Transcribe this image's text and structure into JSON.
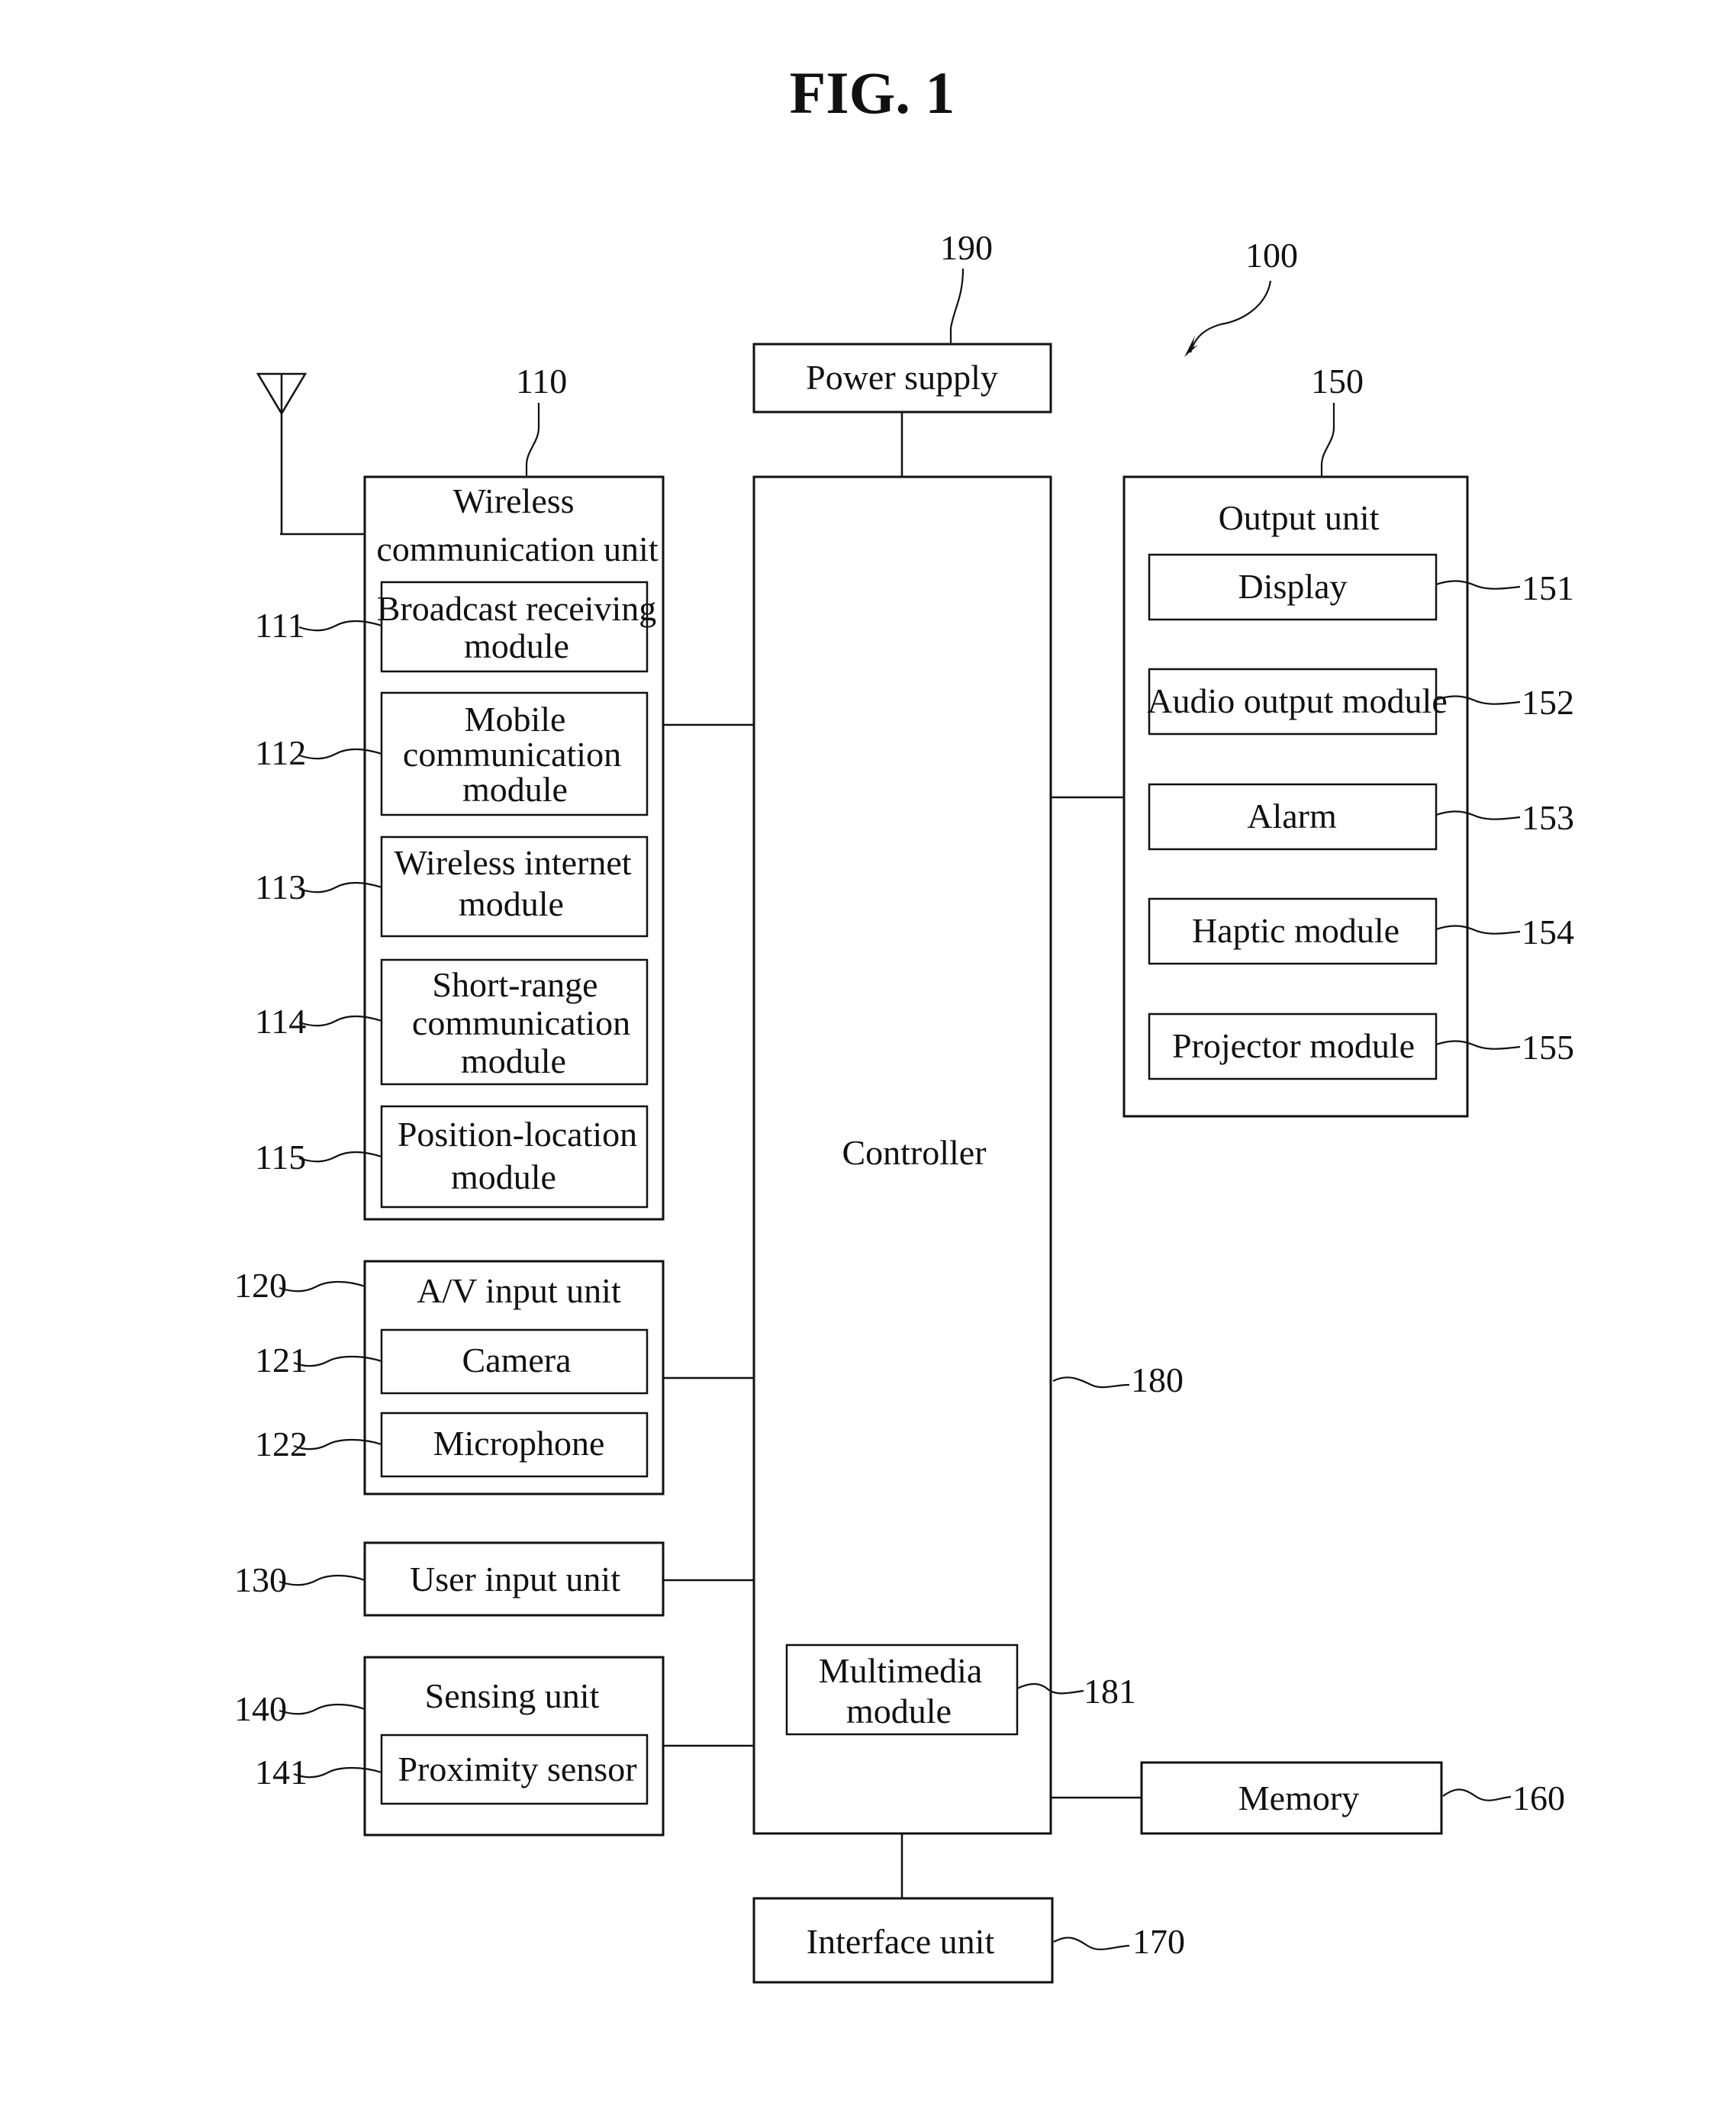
{
  "figure": {
    "title": "FIG. 1",
    "device_ref": "100"
  },
  "power_supply": {
    "label": "Power supply",
    "ref": "190"
  },
  "controller": {
    "label": "Controller",
    "ref": "180",
    "multimedia": {
      "label_lines": [
        "Multimedia",
        "module"
      ],
      "ref": "181"
    }
  },
  "wireless_unit": {
    "label_lines": [
      "Wireless",
      "communication unit"
    ],
    "ref": "110",
    "modules": [
      {
        "ref": "111",
        "label_lines": [
          "Broadcast receiving",
          "module"
        ]
      },
      {
        "ref": "112",
        "label_lines": [
          "Mobile",
          "communication",
          "module"
        ]
      },
      {
        "ref": "113",
        "label_lines": [
          "Wireless internet",
          "module"
        ]
      },
      {
        "ref": "114",
        "label_lines": [
          "Short-range",
          "communication",
          "module"
        ]
      },
      {
        "ref": "115",
        "label_lines": [
          "Position-location",
          "module"
        ]
      }
    ]
  },
  "av_input_unit": {
    "label": "A/V input unit",
    "ref": "120",
    "modules": [
      {
        "ref": "121",
        "label": "Camera"
      },
      {
        "ref": "122",
        "label": "Microphone"
      }
    ]
  },
  "user_input_unit": {
    "label": "User input unit",
    "ref": "130"
  },
  "sensing_unit": {
    "label": "Sensing unit",
    "ref": "140",
    "modules": [
      {
        "ref": "141",
        "label": "Proximity sensor"
      }
    ]
  },
  "output_unit": {
    "label": "Output unit",
    "ref": "150",
    "modules": [
      {
        "ref": "151",
        "label": "Display"
      },
      {
        "ref": "152",
        "label": "Audio output module"
      },
      {
        "ref": "153",
        "label": "Alarm"
      },
      {
        "ref": "154",
        "label": "Haptic module"
      },
      {
        "ref": "155",
        "label": "Projector module"
      }
    ]
  },
  "memory": {
    "label": "Memory",
    "ref": "160"
  },
  "interface_unit": {
    "label": "Interface unit",
    "ref": "170"
  },
  "antenna": {
    "icon": "antenna-icon"
  }
}
